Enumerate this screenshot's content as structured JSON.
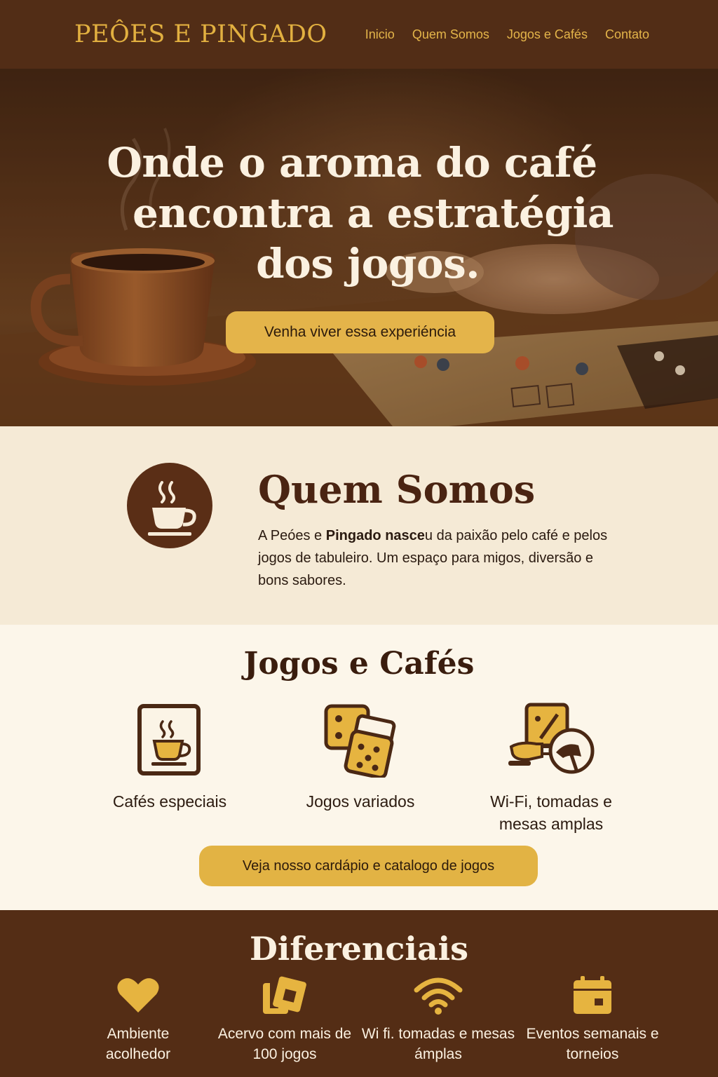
{
  "header": {
    "brand": "PEÔES E PINGADO",
    "nav": [
      "Inicio",
      "Quem Somos",
      "Jogos e Cafés",
      "Contato"
    ]
  },
  "hero": {
    "title_lines": [
      "Onde o aroma do café",
      "encontra a estratégia",
      "dos jogos."
    ],
    "cta": "Venha viver essa experiéncia"
  },
  "about": {
    "title": "Quem Somos",
    "text_part1": "A Peóes e ",
    "text_bold": "Pingado nasce",
    "text_part2": "u da paixão pelo café e pelos jogos de tabuleiro. Um espaço para migos, diversão e bons sabores."
  },
  "games": {
    "title": "Jogos e Cafés",
    "features": [
      {
        "icon": "coffee-card-icon",
        "label": "Cafés especiais"
      },
      {
        "icon": "dice-icon",
        "label": "Jogos variados"
      },
      {
        "icon": "wifi-plug-table-icon",
        "label": "Wi-Fi, tomadas e mesas amplas"
      }
    ],
    "cta": "Veja nosso cardápio e catalogo de jogos"
  },
  "differentials": {
    "title": "Diferenciais",
    "items": [
      {
        "icon": "heart-icon",
        "label": "Ambiente acolhedor"
      },
      {
        "icon": "game-cards-icon",
        "label": "Acervo com mais de 100 jogos"
      },
      {
        "icon": "wifi-icon",
        "label": "Wi fi. tomadas e mesas ámplas"
      },
      {
        "icon": "calendar-icon",
        "label": "Eventos semanais e torneios"
      }
    ]
  },
  "colors": {
    "header_bg": "#522d16",
    "accent_gold": "#e4b44a",
    "dark_brown": "#542d15",
    "cream": "#f5ead6"
  }
}
